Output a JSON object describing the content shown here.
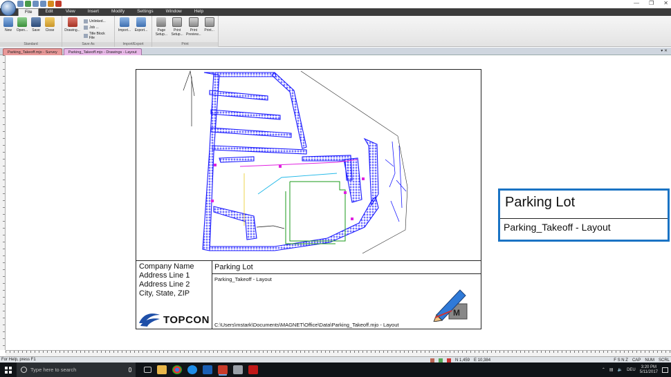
{
  "menu": {
    "tabs": [
      "File",
      "Edit",
      "View",
      "Insert",
      "Modify",
      "Settings",
      "Window",
      "Help"
    ],
    "active": "File"
  },
  "ribbon": {
    "standard": {
      "title": "Standard",
      "new": "New",
      "open": "Open...",
      "save": "Save",
      "close": "Close"
    },
    "save_as": {
      "title": "Save As",
      "drawing": "Drawing...",
      "unlinked": "Unlinked...",
      "job": "Job ...",
      "title_block": "Title Block File"
    },
    "import_export": {
      "title": "Import/Export",
      "import": "Import...",
      "export": "Export..."
    },
    "print": {
      "title": "Print",
      "page_setup_1": "Page",
      "page_setup_2": "Setup...",
      "print_setup_1": "Print",
      "print_setup_2": "Setup...",
      "print_preview_1": "Print",
      "print_preview_2": "Preview...",
      "print": "Print..."
    }
  },
  "doc_tabs": [
    "Parking_Takeoff.mjo - Survey",
    "Parking_Takeoff.mjo - Drawings - Layout"
  ],
  "title_block": {
    "company": "Company Name",
    "address1": "Address Line 1",
    "address2": "Address Line 2",
    "city": "City, State, ZIP",
    "brand": "TOPCON",
    "title": "Parking Lot",
    "subtitle": "Parking_Takeoff - Layout",
    "path": "C:\\Users\\mstark\\Documents\\MAGNET\\Office\\Data\\Parking_Takeoff.mjo - Layout"
  },
  "callout": {
    "title": "Parking Lot",
    "subtitle": "Parking_Takeoff - Layout"
  },
  "status": {
    "help": "For Help, press F1",
    "north": "N 1,459",
    "east": "E 10,384",
    "flags": [
      "F S N Z",
      "CAP",
      "NUM",
      "SCRL"
    ]
  },
  "taskbar": {
    "search_placeholder": "Type here to search",
    "lang": "DEU",
    "time": "3:20 PM",
    "date": "5/11/2017"
  },
  "colors": {
    "drawing_blue": "#1a1aff",
    "selection_blue": "#1a73c4",
    "menubar": "#3c3c3c",
    "taskbar": "#101418"
  }
}
